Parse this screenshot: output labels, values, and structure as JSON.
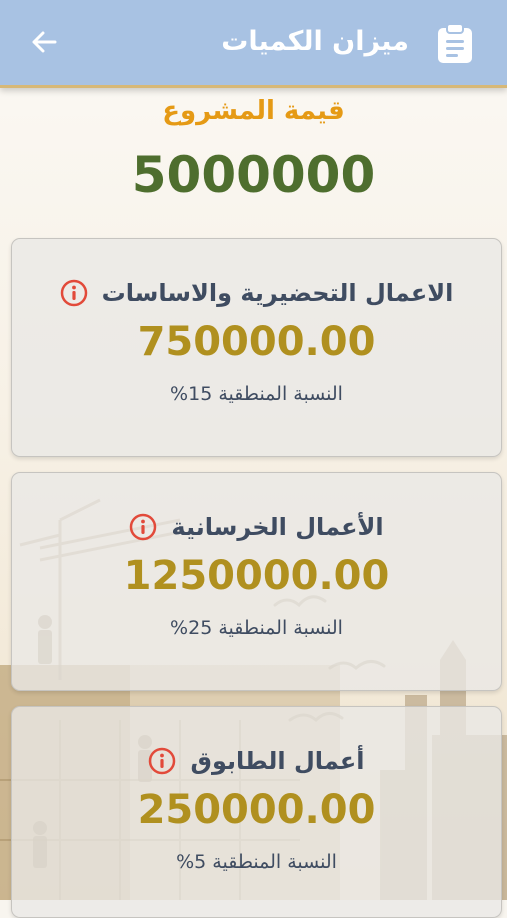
{
  "appbar": {
    "title": "ميزان الكميات",
    "back_icon": "arrow-left-icon",
    "title_icon": "clipboard-icon"
  },
  "project": {
    "label": "قيمة المشروع",
    "value": "5000000"
  },
  "items": [
    {
      "title": "الاعمال التحضيرية والاساسات",
      "amount": "750000.00",
      "ratio": "النسبة المنطقية 15%"
    },
    {
      "title": "الأعمال الخرسانية",
      "amount": "1250000.00",
      "ratio": "النسبة المنطقية 25%"
    },
    {
      "title": "أعمال الطابوق",
      "amount": "250000.00",
      "ratio": "النسبة المنطقية 5%"
    }
  ],
  "colors": {
    "appbar": "#a8c2e3",
    "project_label": "#e59a15",
    "project_value": "#4e6e2e",
    "amount": "#b0901f",
    "info_icon": "#e24a3a"
  }
}
